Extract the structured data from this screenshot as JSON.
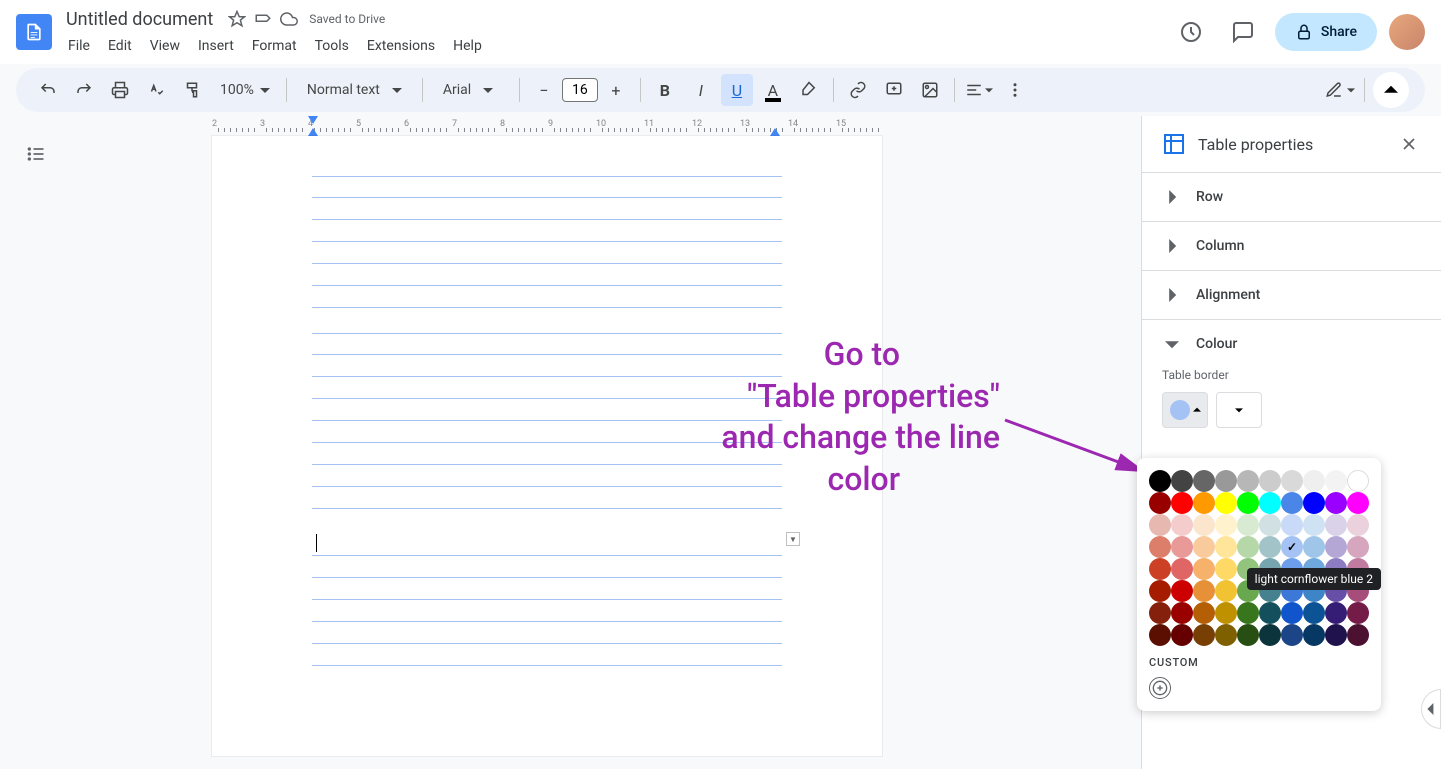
{
  "header": {
    "title": "Untitled document",
    "saved_text": "Saved to Drive",
    "menus": [
      "File",
      "Edit",
      "View",
      "Insert",
      "Format",
      "Tools",
      "Extensions",
      "Help"
    ],
    "share_label": "Share"
  },
  "toolbar": {
    "zoom": "100%",
    "style": "Normal text",
    "font": "Arial",
    "font_size": "16"
  },
  "ruler": {
    "marks": [
      2,
      3,
      4,
      5,
      6,
      7,
      8,
      9,
      10,
      11,
      12,
      13,
      14,
      15
    ]
  },
  "right_panel": {
    "title": "Table properties",
    "sections": {
      "row": "Row",
      "column": "Column",
      "alignment": "Alignment",
      "colour": "Colour"
    },
    "table_border_label": "Table border"
  },
  "color_picker": {
    "custom_label": "CUSTOM",
    "selected_color": "#a4c2f4",
    "tooltip": "light cornflower blue 2",
    "rows": [
      [
        "#000000",
        "#434343",
        "#666666",
        "#999999",
        "#b7b7b7",
        "#cccccc",
        "#d9d9d9",
        "#efefef",
        "#f3f3f3",
        "#ffffff"
      ],
      [
        "#980000",
        "#ff0000",
        "#ff9900",
        "#ffff00",
        "#00ff00",
        "#00ffff",
        "#4a86e8",
        "#0000ff",
        "#9900ff",
        "#ff00ff"
      ],
      [
        "#e6b8af",
        "#f4cccc",
        "#fce5cd",
        "#fff2cc",
        "#d9ead3",
        "#d0e0e3",
        "#c9daf8",
        "#cfe2f3",
        "#d9d2e9",
        "#ead1dc"
      ],
      [
        "#dd7e6b",
        "#ea9999",
        "#f9cb9c",
        "#ffe599",
        "#b6d7a8",
        "#a2c4c9",
        "#a4c2f4",
        "#9fc5e8",
        "#b4a7d6",
        "#d5a6bd"
      ],
      [
        "#cc4125",
        "#e06666",
        "#f6b26b",
        "#ffd966",
        "#93c47d",
        "#76a5af",
        "#6d9eeb",
        "#6fa8dc",
        "#8e7cc3",
        "#c27ba0"
      ],
      [
        "#a61c00",
        "#cc0000",
        "#e69138",
        "#f1c232",
        "#6aa84f",
        "#45818e",
        "#3c78d8",
        "#3d85c6",
        "#674ea7",
        "#a64d79"
      ],
      [
        "#85200c",
        "#990000",
        "#b45f06",
        "#bf9000",
        "#38761d",
        "#134f5c",
        "#1155cc",
        "#0b5394",
        "#351c75",
        "#741b47"
      ],
      [
        "#5b0f00",
        "#660000",
        "#783f04",
        "#7f6000",
        "#274e13",
        "#0c343d",
        "#1c4587",
        "#073763",
        "#20124d",
        "#4c1130"
      ]
    ]
  },
  "annotation": {
    "line1": "Go to",
    "line2": "\"Table properties\"",
    "line3": "and change the line",
    "line4": "color"
  }
}
